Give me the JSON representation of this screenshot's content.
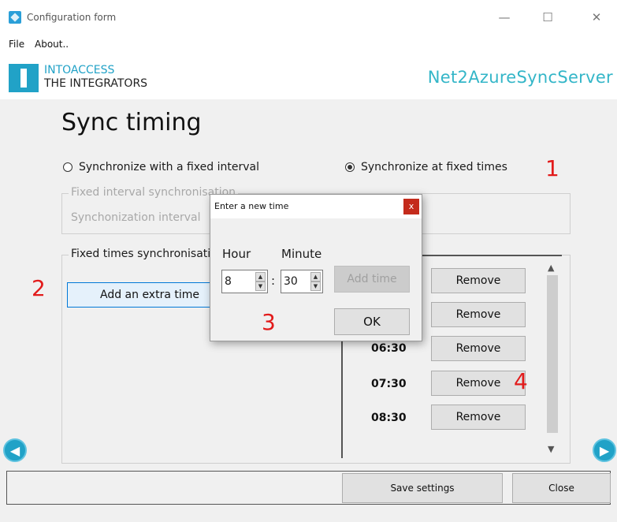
{
  "window": {
    "title": "Configuration form",
    "minimize": "—",
    "maximize": "☐",
    "close": "✕"
  },
  "menu": {
    "items": [
      "File",
      "About.."
    ]
  },
  "brand": {
    "line1": "INTOACCESS",
    "line2": "THE INTEGRATORS",
    "product": "Net2AzureSyncServer",
    "accent": "#21a2c7"
  },
  "page": {
    "title": "Sync timing"
  },
  "mode": {
    "interval_label": "Synchronize with a fixed interval",
    "times_label": "Synchronize at fixed times",
    "selected": "times"
  },
  "interval_group": {
    "title": "Fixed interval synchronisation",
    "label": "Synchonization interval"
  },
  "times_group": {
    "title": "Fixed times synchronisation",
    "add_button": "Add an extra time",
    "remove_label": "Remove",
    "times": [
      "",
      "",
      "06:30",
      "07:30",
      "08:30"
    ]
  },
  "annotations": {
    "a1": "1",
    "a2": "2",
    "a3": "3",
    "a4": "4",
    "color": "#e21b1b"
  },
  "footer": {
    "save": "Save settings",
    "close": "Close"
  },
  "dialog": {
    "title": "Enter a new time",
    "close": "x",
    "hour_label": "Hour",
    "minute_label": "Minute",
    "hour_value": "8",
    "separator": ":",
    "minute_value": "30",
    "add_time": "Add time",
    "ok": "OK"
  },
  "icons": {
    "nav_prev": "arrow-left-icon",
    "nav_next": "arrow-right-icon"
  }
}
